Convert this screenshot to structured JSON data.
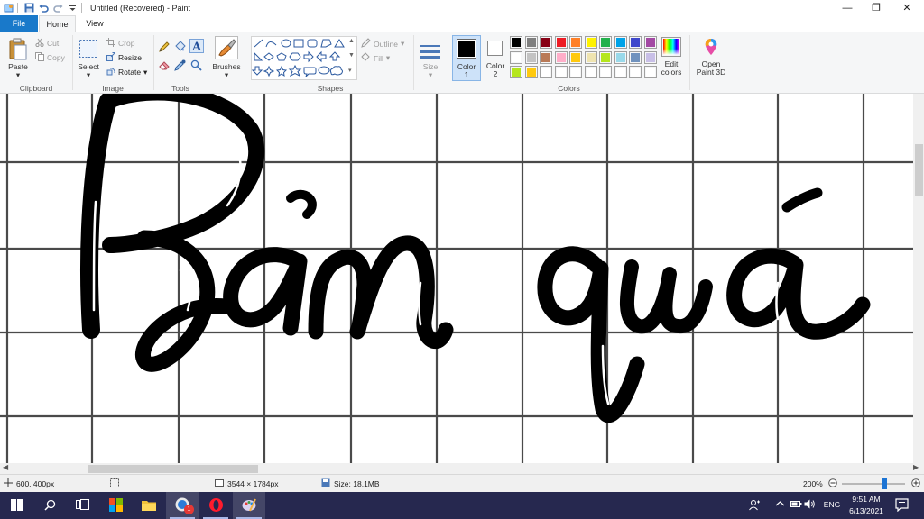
{
  "window": {
    "title": "Untitled (Recovered) - Paint",
    "minimize_glyph": "—",
    "maximize_glyph": "❐",
    "close_glyph": "✕"
  },
  "tabs": [
    {
      "label": "File"
    },
    {
      "label": "Home"
    },
    {
      "label": "View"
    }
  ],
  "ribbon": {
    "clipboard": {
      "paste": "Paste",
      "cut": "Cut",
      "copy": "Copy",
      "group_label": "Clipboard"
    },
    "image": {
      "select": "Select",
      "crop": "Crop",
      "resize": "Resize",
      "rotate": "Rotate",
      "group_label": "Image"
    },
    "tools": {
      "group_label": "Tools"
    },
    "brushes": {
      "label": "Brushes"
    },
    "shapes": {
      "outline": "Outline",
      "fill": "Fill",
      "group_label": "Shapes"
    },
    "size": {
      "label": "Size"
    },
    "colors": {
      "color1": "Color",
      "color1_num": "1",
      "color2": "Color",
      "color2_num": "2",
      "edit_colors_1": "Edit",
      "edit_colors_2": "colors",
      "group_label": "Colors",
      "color1_value": "#000000",
      "color2_value": "#ffffff",
      "palette_row1": [
        "#000000",
        "#7f7f7f",
        "#880015",
        "#ed1c24",
        "#ff7f27",
        "#fff200",
        "#22b14c",
        "#00a2e8",
        "#3f48cc",
        "#a349a4"
      ],
      "palette_row2": [
        "#ffffff",
        "#c3c3c3",
        "#b97a57",
        "#ffaec9",
        "#ffc90e",
        "#efe4b0",
        "#b5e61d",
        "#99d9ea",
        "#7092be",
        "#c8bfe7"
      ],
      "palette_row3": [
        "#b5e61d",
        "#ffc90e",
        "#ffffff",
        "#ffffff",
        "#ffffff",
        "#ffffff",
        "#ffffff",
        "#ffffff",
        "#ffffff",
        "#ffffff"
      ]
    },
    "paint3d": {
      "label_1": "Open",
      "label_2": "Paint 3D"
    }
  },
  "statusbar": {
    "cursor_pos": "600, 400px",
    "dimensions": "3544 × 1784px",
    "size": "Size: 18.1MB",
    "zoom": "200%",
    "zoom_level": 0.67
  },
  "taskbar": {
    "badge_count": "1",
    "lang": "ENG",
    "time": "9:51 AM",
    "date": "6/13/2021"
  }
}
